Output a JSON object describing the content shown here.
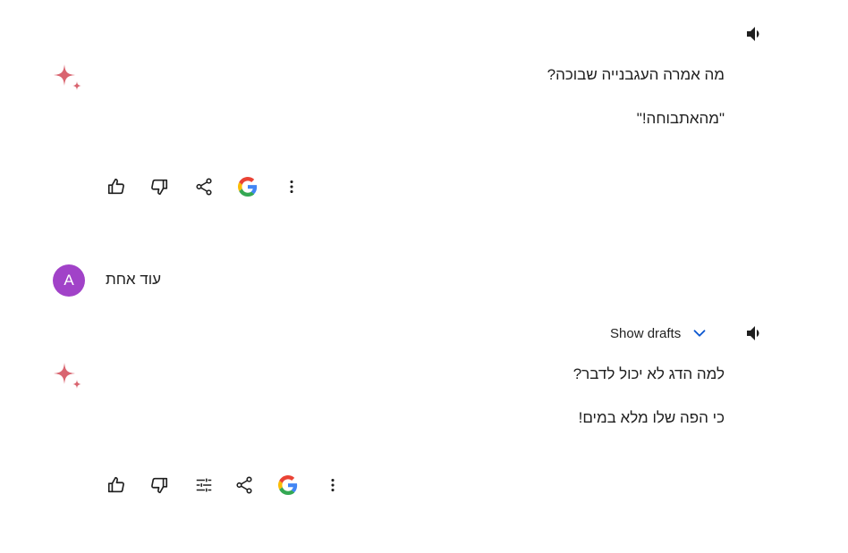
{
  "conversation": {
    "response1": {
      "speaker_icon": "volume-icon",
      "lines": [
        "מה אמרה העגבנייה שבוכה?",
        "\"מהאתבוחה!\""
      ]
    },
    "user_message": {
      "avatar_letter": "A",
      "avatar_color": "#a142c8",
      "text": "עוד אחת"
    },
    "response2": {
      "show_drafts_label": "Show drafts",
      "speaker_icon": "volume-icon",
      "lines": [
        "למה הדג לא יכול לדבר?",
        "כי הפה שלו מלא במים!"
      ]
    }
  },
  "actions": {
    "icons_response1": [
      "thumb-up-icon",
      "thumb-down-icon",
      "share-icon",
      "google-icon",
      "more-vert-icon"
    ],
    "icons_response2": [
      "thumb-up-icon",
      "thumb-down-icon",
      "tune-icon",
      "share-icon",
      "google-icon",
      "more-vert-icon"
    ]
  },
  "colors": {
    "sparkle": "#d96570",
    "accent": "#0b57d0",
    "text": "#1f1f1f"
  }
}
